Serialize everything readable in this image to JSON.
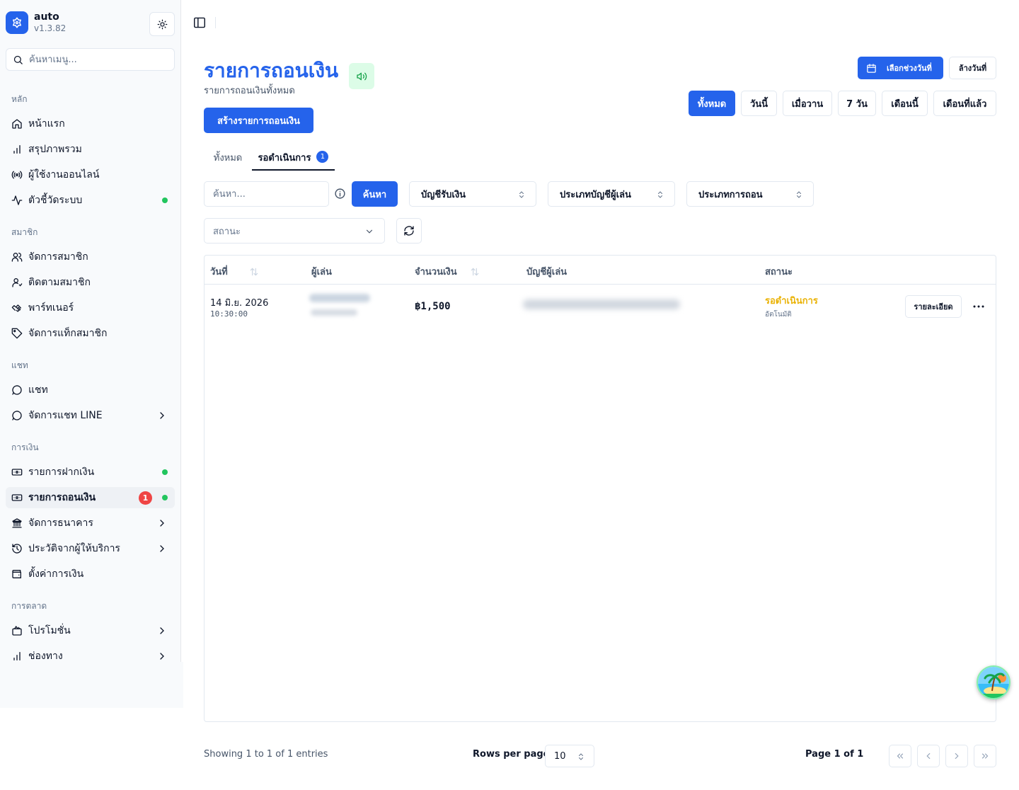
{
  "app": {
    "name": "auto",
    "version": "v1.3.82"
  },
  "sidebar": {
    "search_placeholder": "ค้นหาเมนู...",
    "groups": [
      {
        "label": "หลัก",
        "items": [
          {
            "label": "หน้าแรก",
            "icon": "home-icon"
          },
          {
            "label": "สรุปภาพรวม",
            "icon": "bar-chart-icon"
          },
          {
            "label": "ผู้ใช้งานออนไลน์",
            "icon": "radio-icon"
          },
          {
            "label": "ตัวชี้วัดระบบ",
            "icon": "activity-icon",
            "dot": true
          }
        ]
      },
      {
        "label": "สมาชิก",
        "items": [
          {
            "label": "จัดการสมาชิก",
            "icon": "users-icon"
          },
          {
            "label": "ติดตามสมาชิก",
            "icon": "user-track-icon"
          },
          {
            "label": "พาร์ทเนอร์",
            "icon": "handshake-icon"
          },
          {
            "label": "จัดการแท็กสมาชิก",
            "icon": "tag-icon"
          }
        ]
      },
      {
        "label": "แชท",
        "items": [
          {
            "label": "แชท",
            "icon": "chat-icon"
          },
          {
            "label": "จัดการแชท LINE",
            "icon": "chat-icon",
            "chevron": true
          }
        ]
      },
      {
        "label": "การเงิน",
        "items": [
          {
            "label": "รายการฝากเงิน",
            "icon": "deposit-icon",
            "dot": true
          },
          {
            "label": "รายการถอนเงิน",
            "icon": "withdraw-icon",
            "dot": true,
            "badge": "1",
            "active": true
          },
          {
            "label": "จัดการธนาคาร",
            "icon": "bank-icon",
            "chevron": true
          },
          {
            "label": "ประวัติจากผู้ให้บริการ",
            "icon": "history-icon",
            "chevron": true
          },
          {
            "label": "ตั้งค่าการเงิน",
            "icon": "wallet-icon"
          }
        ]
      },
      {
        "label": "การตลาด",
        "items": [
          {
            "label": "โปรโมชั่น",
            "icon": "promo-icon",
            "chevron": true
          },
          {
            "label": "ช่องทาง",
            "icon": "bar-chart-icon",
            "chevron": true
          }
        ]
      }
    ]
  },
  "header": {
    "title": "รายการถอนเงิน",
    "subtitle": "รายการถอนเงินทั้งหมด",
    "create_label": "สร้างรายการถอนเงิน",
    "date_range_label": "เลือกช่วงวันที่",
    "clear_date_label": "ล้างวันที่",
    "quick_filters": [
      "ทั้งหมด",
      "วันนี้",
      "เมื่อวาน",
      "7 วัน",
      "เดือนนี้",
      "เดือนที่แล้ว"
    ]
  },
  "tabs": [
    {
      "label": "ทั้งหมด"
    },
    {
      "label": "รอดำเนินการ",
      "badge": "1"
    }
  ],
  "filters": {
    "search_placeholder": "ค้นหา...",
    "search_button": "ค้นหา",
    "receive_account": "บัญชีรับเงิน",
    "player_account_type": "ประเภทบัญชีผู้เล่น",
    "withdraw_type": "ประเภทการถอน",
    "status_placeholder": "สถานะ"
  },
  "table": {
    "columns": [
      "วันที่",
      "ผู้เล่น",
      "จำนวนเงิน",
      "บัญชีผู้เล่น",
      "สถานะ"
    ],
    "rows": [
      {
        "date": "14 มิ.ย. 2026",
        "time": "10:30:00",
        "amount": "฿1,500",
        "status": "รอดำเนินการ",
        "status_sub": "อัตโนมัติ",
        "detail_label": "รายละเอียด"
      }
    ]
  },
  "footer": {
    "showing": "Showing 1 to 1 of 1 entries",
    "rows_per_page_label": "Rows per page",
    "rows_per_page": "10",
    "page_info": "Page 1 of 1"
  },
  "colors": {
    "primary": "#2563eb",
    "pending": "#eab308",
    "online_dot": "#22c55e",
    "badge_red": "#ef4444"
  }
}
